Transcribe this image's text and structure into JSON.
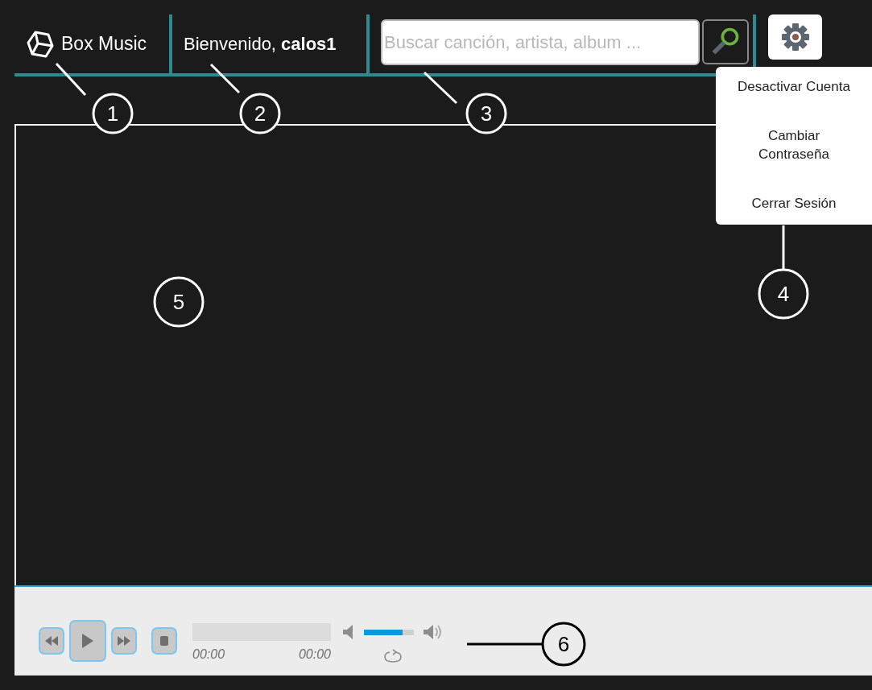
{
  "header": {
    "logo": "Box Music",
    "welcome": "Bienvenido, **calos1**",
    "search": {
      "placeholder": "Buscar canción, artista, album ..."
    }
  },
  "settings_menu": {
    "items": [
      "Desactivar Cuenta",
      "Cambiar\nContraseña",
      "Cerrar Sesión"
    ]
  },
  "player": {
    "time_elapsed": "00:00",
    "time_total": "00:00",
    "volume": {
      "level": 0.78
    }
  },
  "annotations": [
    {
      "label": "1",
      "kind": "dark"
    },
    {
      "label": "2",
      "kind": "dark"
    },
    {
      "label": "3",
      "kind": "dark"
    },
    {
      "label": "4",
      "kind": "dark"
    },
    {
      "label": "5",
      "kind": "dark"
    },
    {
      "label": "6",
      "kind": "light"
    }
  ]
}
